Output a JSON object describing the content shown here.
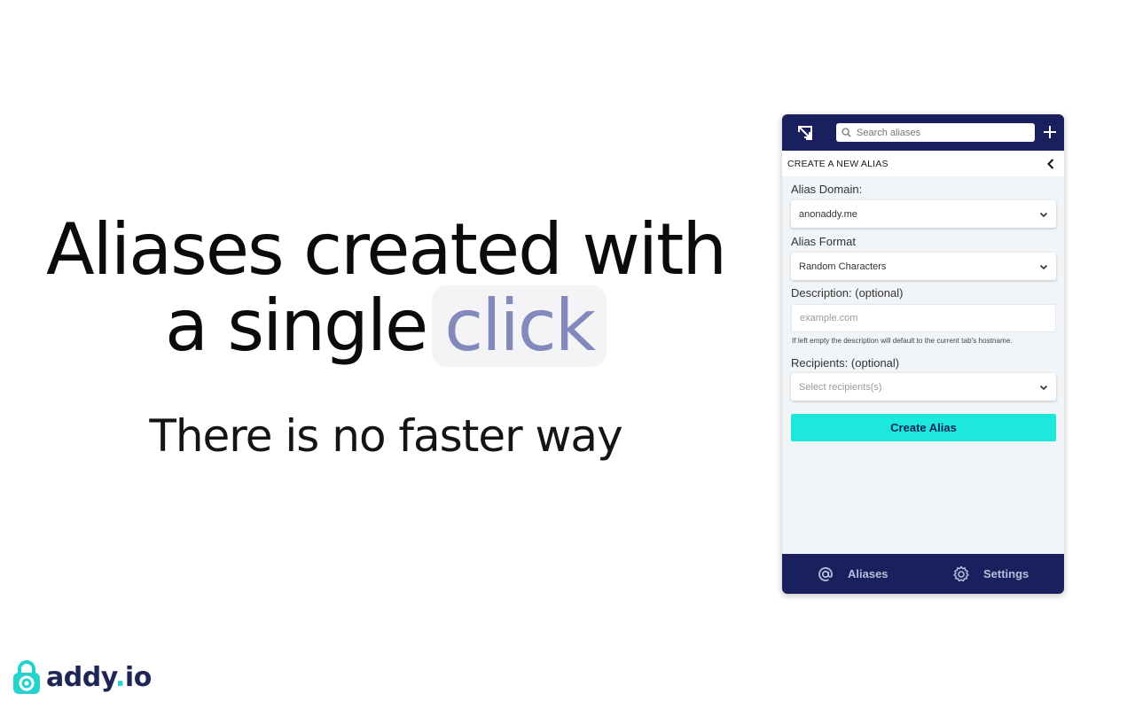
{
  "hero": {
    "line1": "Aliases created with",
    "line2_prefix": "a single",
    "line2_highlight": "click",
    "tagline": "There is no faster way"
  },
  "logo": {
    "name": "addy",
    "dot": ".",
    "tld": "io"
  },
  "popup": {
    "search": {
      "placeholder": "Search aliases"
    },
    "section_title": "CREATE A NEW ALIAS",
    "alias_domain": {
      "label": "Alias Domain:",
      "value": "anonaddy.me"
    },
    "alias_format": {
      "label": "Alias Format",
      "value": "Random Characters"
    },
    "description": {
      "label": "Description: (optional)",
      "placeholder": "example.com",
      "hint": "If left empty the description will default to the current tab's hostname."
    },
    "recipients": {
      "label": "Recipients: (optional)",
      "placeholder": "Select recipients(s)"
    },
    "create_button": "Create Alias",
    "nav": {
      "aliases": "Aliases",
      "settings": "Settings"
    }
  },
  "colors": {
    "brand_navy": "#1a1f5e",
    "accent_teal": "#1ce9db",
    "highlight_text": "#8289bd",
    "logo_teal": "#23d3cc"
  },
  "icons": [
    "expand-icon",
    "search-icon",
    "plus-icon",
    "chevron-left-icon",
    "chevron-down-icon",
    "at-sign-icon",
    "gear-icon",
    "padlock-logo-icon"
  ]
}
